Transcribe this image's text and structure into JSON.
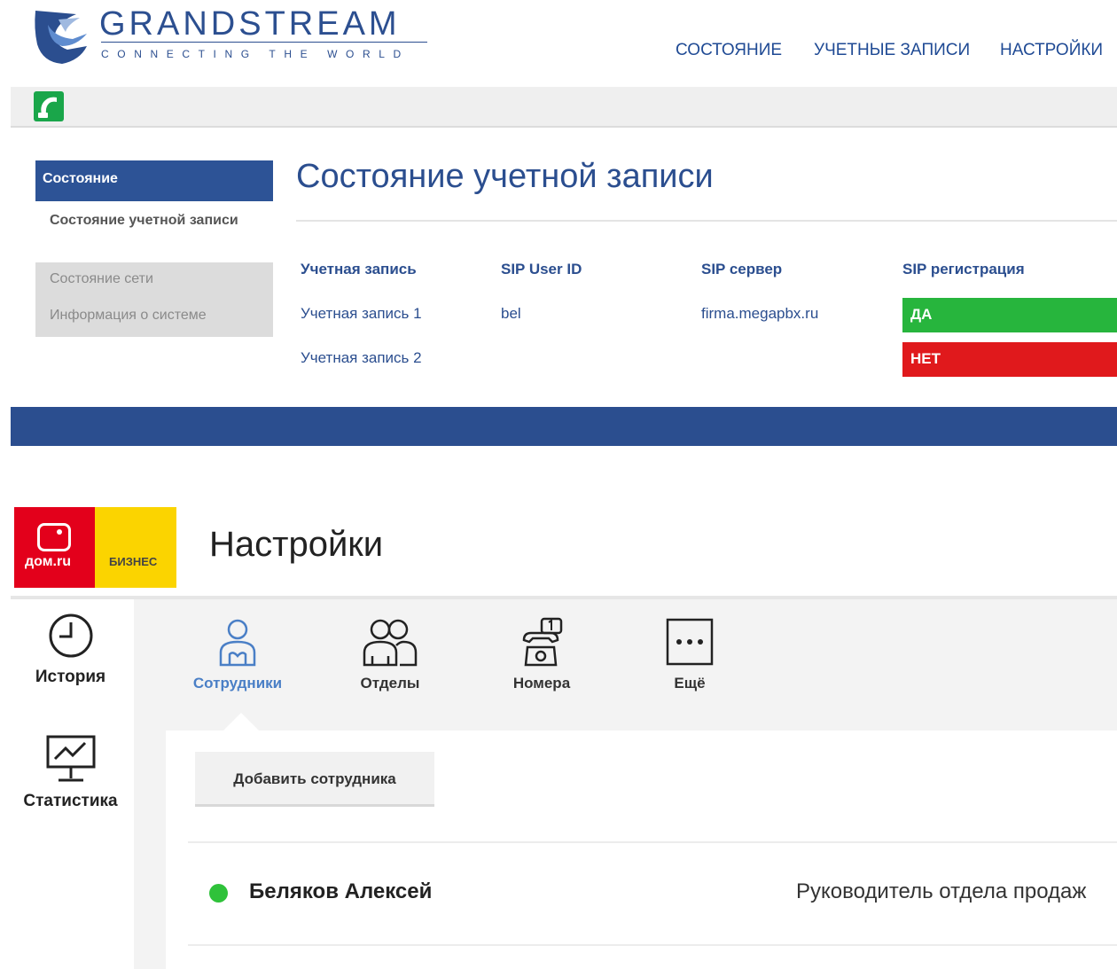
{
  "grandstream": {
    "brand": "GRANDSTREAM",
    "tagline": "CONNECTING THE WORLD",
    "nav": [
      "СОСТОЯНИЕ",
      "УЧЕТНЫЕ ЗАПИСИ",
      "НАСТРОЙКИ"
    ],
    "sidebar": {
      "active": "Состояние",
      "current_sub": "Состояние учетной записи",
      "items": [
        "Состояние сети",
        "Информация о системе"
      ]
    },
    "page_title": "Состояние учетной записи",
    "table": {
      "headers": [
        "Учетная запись",
        "SIP User ID",
        "SIP сервер",
        "SIP регистрация"
      ],
      "rows": [
        {
          "account": "Учетная запись 1",
          "user_id": "bel",
          "server": "firma.megapbx.ru",
          "registration": "ДА"
        },
        {
          "account": "Учетная запись 2",
          "user_id": "",
          "server": "",
          "registration": "НЕТ"
        }
      ]
    },
    "colors": {
      "brand_blue": "#2b4e8f",
      "ok": "#27b53d",
      "fail": "#e0191c"
    }
  },
  "domru": {
    "logo_text": "дом.ru",
    "logo_biz": "БИЗНЕС",
    "title": "Настройки",
    "left_nav": [
      "История",
      "Статистика"
    ],
    "tabs": [
      "Сотрудники",
      "Отделы",
      "Номера",
      "Ещё"
    ],
    "add_button": "Добавить сотрудника",
    "employee": {
      "name": "Беляков Алексей",
      "role": "Руководитель отдела продаж",
      "status_color": "#2fc23a"
    }
  }
}
